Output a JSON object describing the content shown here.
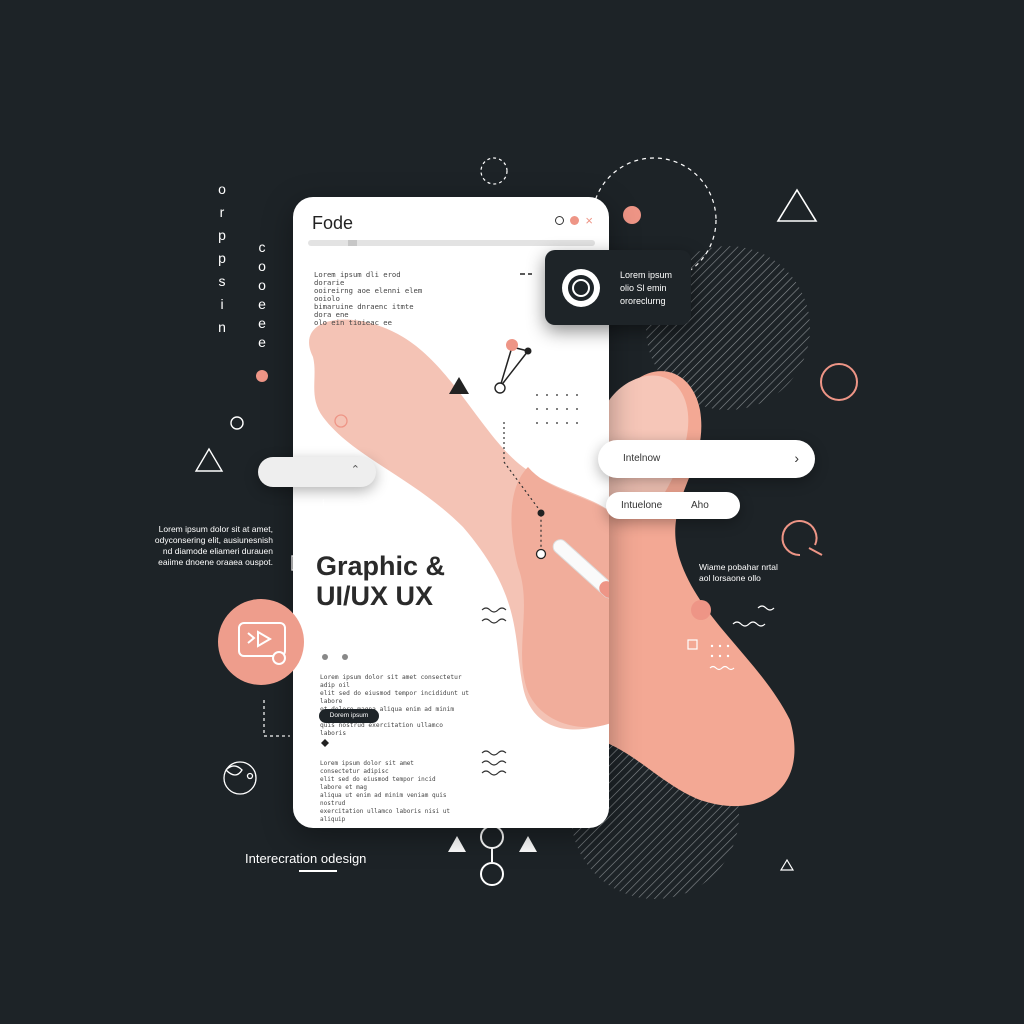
{
  "colors": {
    "background": "#1d2327",
    "accent": "#ee9586",
    "accent_light": "#f4c2b5",
    "card_white": "#ffffff",
    "dark_card": "#1e2428"
  },
  "phone": {
    "title": "Fode",
    "paragraph_top": [
      "Lorem ipsum dli erod dorarie",
      "ooireirng aoe elenni elem ooiolo",
      "bimaruine dnraenc itmte dora ene",
      "olo ein tioieac ee"
    ],
    "headline_line1": "Graphic &",
    "headline_line2": "UI/UX UX",
    "paragraph_mid": [
      "Lorem ipsum dolor sit amet consectetur adip oil",
      "elit sed do eiusmod tempor incididunt ut labore",
      "et dolore magna aliqua enim ad minim veniam",
      "quis nostrud exercitation ullamco laboris"
    ],
    "button_label": "Dorem ipsum",
    "paragraph_bottom": [
      "Lorem ipsum dolor sit amet consectetur adipisc",
      "elit sed do eiusmod tempor incid labore et mag",
      "aliqua ut enim ad minim veniam quis nostrud",
      "exercitation ullamco laboris nisi ut aliquip"
    ]
  },
  "dark_card": {
    "lines": [
      "Lorem ipsum",
      "olio Sl emin",
      "ororeclurng"
    ],
    "icon": "record-icon"
  },
  "pill_right": {
    "label": "Intelnow",
    "icon": "chevron-right-icon"
  },
  "pill_small": {
    "label": "Intuelone",
    "value": "Aho"
  },
  "pill_left": {
    "icon": "chevron-up-icon",
    "hint": "i"
  },
  "left_text": [
    "Lorem ipsum dolor sit at amet,",
    "odyconsering elit, ausiunesnish",
    "nd diamode eliameri durauen",
    "eaiime dnoene oraaea ouspot."
  ],
  "right_text": [
    "Wiame pobahar nrtal",
    "aol lorsaone ollo"
  ],
  "vertical_letters_left": [
    "o",
    "r",
    "p",
    "p",
    "s",
    "i",
    "n"
  ],
  "vertical_letters_right": [
    "c",
    "o",
    "o",
    "e",
    "e",
    "e"
  ],
  "footer": {
    "title": "Interecration odesign"
  },
  "play_badge": {
    "icon": "play-video-icon"
  }
}
